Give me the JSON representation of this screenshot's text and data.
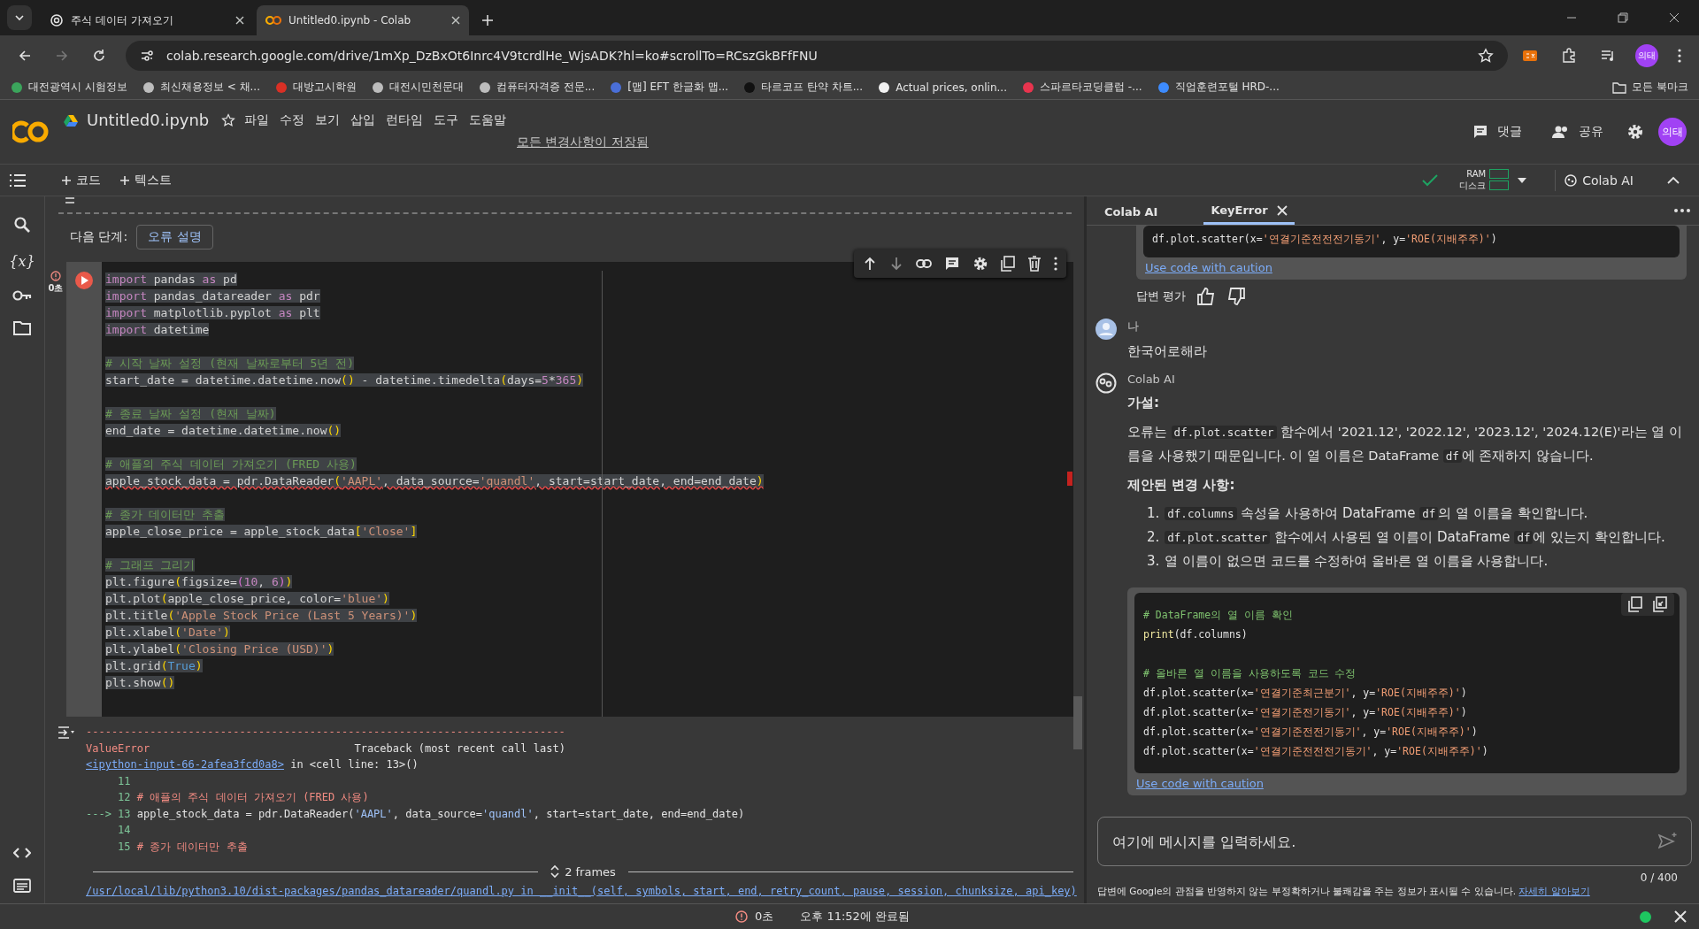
{
  "browser": {
    "tabs": [
      {
        "title": "주식 데이터 가져오기",
        "selected": false,
        "kind": "chat"
      },
      {
        "title": "Untitled0.ipynb - Colab",
        "selected": true,
        "kind": "colab"
      }
    ],
    "url": "colab.research.google.com/drive/1mXp_DzBxOt6Inrc4V9tcrdlHe_WjsADK?hl=ko#scrollTo=RCszGkBFfFNU",
    "profile": "의태",
    "bookmarks": [
      {
        "label": "대전광역시 시험정보",
        "color": "#3ba55c"
      },
      {
        "label": "최신채용정보 < 채...",
        "color": "#bdbdbd"
      },
      {
        "label": "대방고시학원",
        "color": "#d93025"
      },
      {
        "label": "대전시민천문대",
        "color": "#bdbdbd"
      },
      {
        "label": "컴퓨터자격증 전문...",
        "color": "#bdbdbd"
      },
      {
        "label": "[맵] EFT 한글화 맵...",
        "color": "#4a6fd8"
      },
      {
        "label": "타르코프 탄약 차트...",
        "color": "#111111"
      },
      {
        "label": "Actual prices, onlin...",
        "color": "#f2f2f2"
      },
      {
        "label": "스파르타코딩클럽 -...",
        "color": "#e8344e"
      },
      {
        "label": "직업훈련포털 HRD-...",
        "color": "#3d8bfd"
      }
    ],
    "all_bookmarks": "모든 북마크"
  },
  "colab": {
    "title": "Untitled0.ipynb",
    "menu": [
      "파일",
      "수정",
      "보기",
      "삽입",
      "런타임",
      "도구",
      "도움말"
    ],
    "saved": "모든 변경사항이 저장됨",
    "comments": "댓글",
    "share": "공유",
    "avatar": "의태"
  },
  "toolbar": {
    "add_code": "코드",
    "add_text": "텍스트",
    "ram": "RAM",
    "disk": "디스크",
    "ai": "Colab AI"
  },
  "rail": {
    "variables": "{x}"
  },
  "notebook": {
    "next_steps": "다음 단계:",
    "explain": "오류 설명",
    "cell": {
      "exec_time": "0초",
      "lines": [
        {
          "kind": "code",
          "error": false,
          "segs": [
            {
              "text": "import",
              "kind": "kw"
            },
            {
              "text": " pandas ",
              "kind": "plain"
            },
            {
              "text": "as",
              "kind": "kw"
            },
            {
              "text": " pd",
              "kind": "plain"
            }
          ]
        },
        {
          "kind": "code",
          "error": false,
          "segs": [
            {
              "text": "import",
              "kind": "kw"
            },
            {
              "text": " pandas_datareader ",
              "kind": "plain"
            },
            {
              "text": "as",
              "kind": "kw"
            },
            {
              "text": " pdr",
              "kind": "plain"
            }
          ]
        },
        {
          "kind": "code",
          "error": false,
          "segs": [
            {
              "text": "import",
              "kind": "kw"
            },
            {
              "text": " matplotlib.pyplot ",
              "kind": "plain"
            },
            {
              "text": "as",
              "kind": "kw"
            },
            {
              "text": " plt",
              "kind": "plain"
            }
          ]
        },
        {
          "kind": "code",
          "error": false,
          "segs": [
            {
              "text": "import",
              "kind": "kw"
            },
            {
              "text": " datetime",
              "kind": "plain"
            }
          ]
        },
        {
          "kind": "blank"
        },
        {
          "kind": "code",
          "error": false,
          "segs": [
            {
              "text": "# 시작 날짜 설정 (현재 날짜로부터 5년 전)",
              "kind": "cmt"
            }
          ]
        },
        {
          "kind": "code",
          "error": false,
          "segs": [
            {
              "text": "start_date = datetime.datetime.now",
              "kind": "plain"
            },
            {
              "text": "()",
              "kind": "br"
            },
            {
              "text": " - datetime.timedelta",
              "kind": "plain"
            },
            {
              "text": "(",
              "kind": "br"
            },
            {
              "text": "days=",
              "kind": "plain"
            },
            {
              "text": "5",
              "kind": "num"
            },
            {
              "text": "*",
              "kind": "plain"
            },
            {
              "text": "365",
              "kind": "num"
            },
            {
              "text": ")",
              "kind": "br"
            }
          ]
        },
        {
          "kind": "blank"
        },
        {
          "kind": "code",
          "error": false,
          "segs": [
            {
              "text": "# 종료 날짜 설정 (현재 날짜)",
              "kind": "cmt"
            }
          ]
        },
        {
          "kind": "code",
          "error": false,
          "segs": [
            {
              "text": "end_date = datetime.datetime.now",
              "kind": "plain"
            },
            {
              "text": "()",
              "kind": "br"
            }
          ]
        },
        {
          "kind": "blank"
        },
        {
          "kind": "code",
          "error": false,
          "segs": [
            {
              "text": "# 애플의 주식 데이터 가져오기 (FRED 사용)",
              "kind": "cmt"
            }
          ]
        },
        {
          "kind": "code",
          "error": true,
          "segs": [
            {
              "text": "apple_stock_data = pdr.DataReader",
              "kind": "plain"
            },
            {
              "text": "(",
              "kind": "br"
            },
            {
              "text": "'AAPL'",
              "kind": "str"
            },
            {
              "text": ", data_source=",
              "kind": "plain"
            },
            {
              "text": "'quandl'",
              "kind": "str"
            },
            {
              "text": ", start=start_date, end=end_date",
              "kind": "plain"
            },
            {
              "text": ")",
              "kind": "br"
            }
          ]
        },
        {
          "kind": "blank"
        },
        {
          "kind": "code",
          "error": false,
          "segs": [
            {
              "text": "# 종가 데이터만 추출",
              "kind": "cmt"
            }
          ]
        },
        {
          "kind": "code",
          "error": false,
          "segs": [
            {
              "text": "apple_close_price = apple_stock_data",
              "kind": "plain"
            },
            {
              "text": "[",
              "kind": "br"
            },
            {
              "text": "'Close'",
              "kind": "str"
            },
            {
              "text": "]",
              "kind": "br"
            }
          ]
        },
        {
          "kind": "blank"
        },
        {
          "kind": "code",
          "error": false,
          "segs": [
            {
              "text": "# 그래프 그리기",
              "kind": "cmt"
            }
          ]
        },
        {
          "kind": "code",
          "error": false,
          "segs": [
            {
              "text": "plt.figure",
              "kind": "plain"
            },
            {
              "text": "(",
              "kind": "br"
            },
            {
              "text": "figsize=",
              "kind": "plain"
            },
            {
              "text": "(",
              "kind": "br2"
            },
            {
              "text": "10",
              "kind": "num"
            },
            {
              "text": ", ",
              "kind": "plain"
            },
            {
              "text": "6",
              "kind": "num"
            },
            {
              "text": ")",
              "kind": "br2"
            },
            {
              "text": ")",
              "kind": "br"
            }
          ]
        },
        {
          "kind": "code",
          "error": false,
          "segs": [
            {
              "text": "plt.plot",
              "kind": "plain"
            },
            {
              "text": "(",
              "kind": "br"
            },
            {
              "text": "apple_close_price, color=",
              "kind": "plain"
            },
            {
              "text": "'blue'",
              "kind": "str"
            },
            {
              "text": ")",
              "kind": "br"
            }
          ]
        },
        {
          "kind": "code",
          "error": false,
          "segs": [
            {
              "text": "plt.title",
              "kind": "plain"
            },
            {
              "text": "(",
              "kind": "br"
            },
            {
              "text": "'Apple Stock Price (Last 5 Years)'",
              "kind": "str"
            },
            {
              "text": ")",
              "kind": "br"
            }
          ]
        },
        {
          "kind": "code",
          "error": false,
          "segs": [
            {
              "text": "plt.xlabel",
              "kind": "plain"
            },
            {
              "text": "(",
              "kind": "br"
            },
            {
              "text": "'Date'",
              "kind": "str"
            },
            {
              "text": ")",
              "kind": "br"
            }
          ]
        },
        {
          "kind": "code",
          "error": false,
          "segs": [
            {
              "text": "plt.ylabel",
              "kind": "plain"
            },
            {
              "text": "(",
              "kind": "br"
            },
            {
              "text": "'Closing Price (USD)'",
              "kind": "str"
            },
            {
              "text": ")",
              "kind": "br"
            }
          ]
        },
        {
          "kind": "code",
          "error": false,
          "segs": [
            {
              "text": "plt.grid",
              "kind": "plain"
            },
            {
              "text": "(",
              "kind": "br"
            },
            {
              "text": "True",
              "kind": "const"
            },
            {
              "text": ")",
              "kind": "br"
            }
          ]
        },
        {
          "kind": "code",
          "error": false,
          "segs": [
            {
              "text": "plt.show",
              "kind": "plain"
            },
            {
              "text": "()",
              "kind": "br"
            }
          ]
        }
      ]
    },
    "output": {
      "lines": [
        [
          {
            "text": "---------------------------------------------------------------------------",
            "kind": "red"
          }
        ],
        [
          {
            "text": "ValueError",
            "kind": "red"
          },
          {
            "text": "                                Traceback (most recent call last)",
            "kind": "plain"
          }
        ],
        [
          {
            "text": "<ipython-input-66-2afea3fcd0a8>",
            "kind": "link"
          },
          {
            "text": " in <cell line: 13>()",
            "kind": "plain"
          }
        ],
        [
          {
            "text": "     11",
            "kind": "green"
          }
        ],
        [
          {
            "text": "     12 ",
            "kind": "green"
          },
          {
            "text": "# 애플의 주식 데이터 가져오기 (FRED 사용)",
            "kind": "red"
          }
        ],
        [
          {
            "text": "---> 13 ",
            "kind": "green"
          },
          {
            "text": "apple_stock_data = pdr.DataReader(",
            "kind": "plain"
          },
          {
            "text": "'AAPL'",
            "kind": "tstr"
          },
          {
            "text": ", data_source=",
            "kind": "plain"
          },
          {
            "text": "'quandl'",
            "kind": "tstr"
          },
          {
            "text": ", start=start_date, end=end_date)",
            "kind": "plain"
          }
        ],
        [
          {
            "text": "     14",
            "kind": "green"
          }
        ],
        [
          {
            "text": "     15 ",
            "kind": "green"
          },
          {
            "text": "# 종가 데이터만 추출",
            "kind": "red"
          }
        ]
      ],
      "frames": "2 frames",
      "path": "/usr/local/lib/python3.10/dist-packages/pandas_datareader/quandl.py in __init__(self, symbols, start, end, retry_count, pause, session, chunksize, api_key)"
    }
  },
  "ai_panel": {
    "tabs": [
      {
        "label": "Colab AI",
        "selected": false,
        "closable": false
      },
      {
        "label": "KeyError",
        "selected": true,
        "closable": true
      }
    ],
    "top_code": [
      {
        "text": "df.plot.scatter(x=",
        "kind": "plain"
      },
      {
        "text": "'연결기준전전전기동기'",
        "kind": "str"
      },
      {
        "text": ", y=",
        "kind": "plain"
      },
      {
        "text": "'ROE(지배주주)'",
        "kind": "str"
      },
      {
        "text": ")",
        "kind": "plain"
      }
    ],
    "caution_top": "Use code with caution",
    "rate": "답변 평가",
    "user": {
      "name": "나",
      "text": "한국어로해라"
    },
    "bot": {
      "name": "Colab AI",
      "blocks": [
        {
          "kind": "heading",
          "text": "가설:"
        },
        {
          "kind": "paragraph",
          "segs": [
            {
              "text": "오류는 ",
              "kind": "text"
            },
            {
              "text": "df.plot.scatter",
              "kind": "code"
            },
            {
              "text": " 함수에서 '2021.12', '2022.12', '2023.12', '2024.12(E)'라는 열 이름을 사용했기 때문입니다. 이 열 이름은 DataFrame ",
              "kind": "text"
            },
            {
              "text": "df",
              "kind": "code"
            },
            {
              "text": "에 존재하지 않습니다.",
              "kind": "text"
            }
          ]
        },
        {
          "kind": "heading",
          "text": "제안된 변경 사항:"
        },
        {
          "kind": "list",
          "items": [
            {
              "number": "1.",
              "segs": [
                {
                  "text": "df.columns",
                  "kind": "code"
                },
                {
                  "text": " 속성을 사용하여 DataFrame ",
                  "kind": "text"
                },
                {
                  "text": "df",
                  "kind": "code"
                },
                {
                  "text": "의 열 이름을 확인합니다.",
                  "kind": "text"
                }
              ]
            },
            {
              "number": "2.",
              "segs": [
                {
                  "text": "df.plot.scatter",
                  "kind": "code"
                },
                {
                  "text": " 함수에서 사용된 열 이름이 DataFrame ",
                  "kind": "text"
                },
                {
                  "text": "df",
                  "kind": "code"
                },
                {
                  "text": "에 있는지 확인합니다.",
                  "kind": "text"
                }
              ]
            },
            {
              "number": "3.",
              "segs": [
                {
                  "text": "열 이름이 없으면 코드를 수정하여 올바른 열 이름을 사용합니다.",
                  "kind": "text"
                }
              ]
            }
          ]
        },
        {
          "kind": "code",
          "lines": [
            {
              "kind": "code",
              "segs": [
                {
                  "text": "# DataFrame의 열 이름 확인",
                  "kind": "cmt"
                }
              ]
            },
            {
              "kind": "code",
              "segs": [
                {
                  "text": "print",
                  "kind": "fn"
                },
                {
                  "text": "(df.columns)",
                  "kind": "plain"
                }
              ]
            },
            {
              "kind": "blank"
            },
            {
              "kind": "code",
              "segs": [
                {
                  "text": "# 올바른 열 이름을 사용하도록 코드 수정",
                  "kind": "cmt"
                }
              ]
            },
            {
              "kind": "code",
              "segs": [
                {
                  "text": "df.plot.scatter(x=",
                  "kind": "plain"
                },
                {
                  "text": "'연결기준최근분기'",
                  "kind": "str"
                },
                {
                  "text": ", y=",
                  "kind": "plain"
                },
                {
                  "text": "'ROE(지배주주)'",
                  "kind": "str"
                },
                {
                  "text": ")",
                  "kind": "plain"
                }
              ]
            },
            {
              "kind": "code",
              "segs": [
                {
                  "text": "df.plot.scatter(x=",
                  "kind": "plain"
                },
                {
                  "text": "'연결기준전기동기'",
                  "kind": "str"
                },
                {
                  "text": ", y=",
                  "kind": "plain"
                },
                {
                  "text": "'ROE(지배주주)'",
                  "kind": "str"
                },
                {
                  "text": ")",
                  "kind": "plain"
                }
              ]
            },
            {
              "kind": "code",
              "segs": [
                {
                  "text": "df.plot.scatter(x=",
                  "kind": "plain"
                },
                {
                  "text": "'연결기준전전기동기'",
                  "kind": "str"
                },
                {
                  "text": ", y=",
                  "kind": "plain"
                },
                {
                  "text": "'ROE(지배주주)'",
                  "kind": "str"
                },
                {
                  "text": ")",
                  "kind": "plain"
                }
              ]
            },
            {
              "kind": "code",
              "segs": [
                {
                  "text": "df.plot.scatter(x=",
                  "kind": "plain"
                },
                {
                  "text": "'연결기준전전전기동기'",
                  "kind": "str"
                },
                {
                  "text": ", y=",
                  "kind": "plain"
                },
                {
                  "text": "'ROE(지배주주)'",
                  "kind": "str"
                },
                {
                  "text": ")",
                  "kind": "plain"
                }
              ]
            }
          ],
          "caution": "Use code with caution"
        }
      ]
    },
    "input": {
      "placeholder": "여기에 메시지를 입력하세요."
    },
    "counter": "0 / 400",
    "disclaimer": "답변에 Google의 관점을 반영하지 않는 부정확하거나 불쾌감을 주는 정보가 표시될 수 있습니다.",
    "learn_more": "자세히 알아보기"
  },
  "status": {
    "time": "0초",
    "completed": "오후 11:52에 완료됨"
  }
}
